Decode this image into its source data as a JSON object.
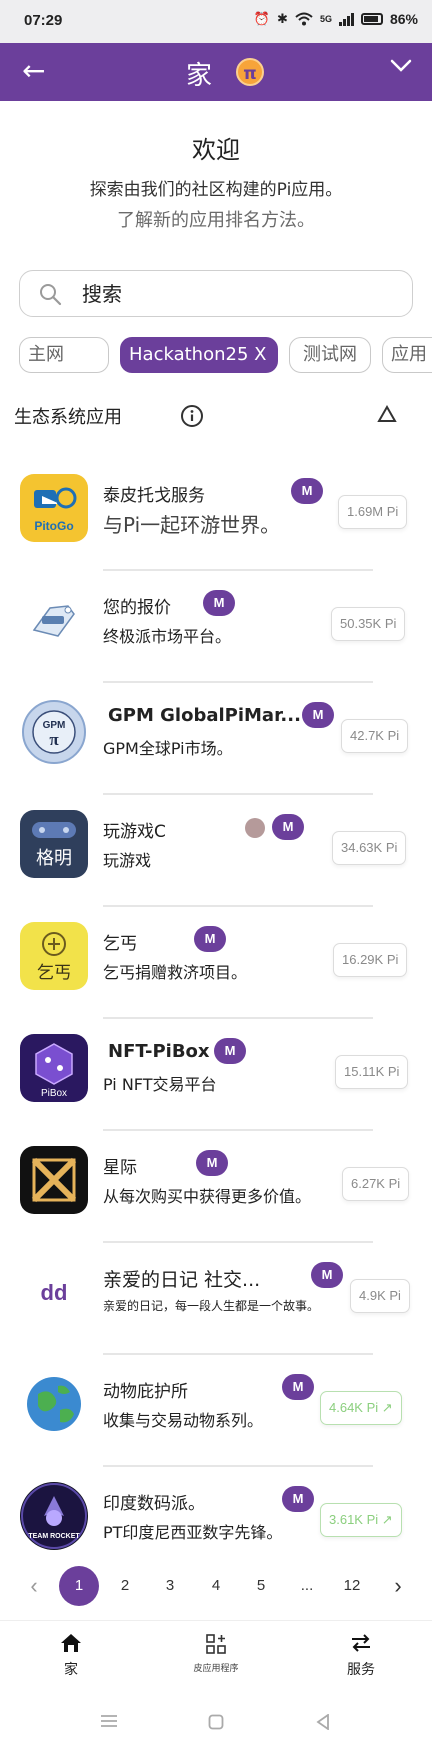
{
  "status": {
    "time": "07:29",
    "network": "5G",
    "battery": "86%"
  },
  "header": {
    "title": "家",
    "pi_symbol": "π"
  },
  "welcome": {
    "title": "欢迎",
    "subtitle": "探索由我们的社区构建的Pi应用。",
    "link": "了解新的应用排名方法。"
  },
  "search": {
    "placeholder": "搜索"
  },
  "filters": [
    "主网",
    "Hackathon25 X",
    "测试网",
    "应用"
  ],
  "section": {
    "title": "生态系统应用"
  },
  "badge_label": "M",
  "apps": [
    {
      "name": "泰皮托戈服务",
      "desc": "与Pi一起环游世界。",
      "pi": "1.69M Pi",
      "icon_text": "PitoGo",
      "trend": false
    },
    {
      "name": "您的报价",
      "desc": "终极派市场平台。",
      "pi": "50.35K Pi",
      "icon_text": "",
      "trend": false
    },
    {
      "name": "GPM GlobalPiMar...",
      "desc": "GPM全球Pi市场。",
      "pi": "42.7K Pi",
      "icon_text": "GPM",
      "trend": false
    },
    {
      "name": "玩游戏C",
      "desc": "玩游戏",
      "pi": "34.63K Pi",
      "icon_text": "格明",
      "trend": false
    },
    {
      "name": "乞丐",
      "desc": "乞丐捐赠救济项目。",
      "pi": "16.29K Pi",
      "icon_text": "乞丐",
      "trend": false
    },
    {
      "name": "NFT-PiBox",
      "desc": "Pi NFT交易平台",
      "pi": "15.11K Pi",
      "icon_text": "PiBox",
      "trend": false
    },
    {
      "name": "星际",
      "desc": "从每次购买中获得更多价值。",
      "pi": "6.27K Pi",
      "icon_text": "",
      "trend": false
    },
    {
      "name": "亲爱的日记 社交...",
      "desc": "亲爱的日记，每一段人生都是一个故事。",
      "pi": "4.9K Pi",
      "icon_text": "dd",
      "trend": false
    },
    {
      "name": "动物庇护所",
      "desc": "收集与交易动物系列。",
      "pi": "4.64K Pi",
      "icon_text": "",
      "trend": true
    },
    {
      "name": "印度数码派。",
      "desc": "PT印度尼西亚数字先锋。",
      "pi": "3.61K Pi",
      "icon_text": "TEAM ROCKET",
      "trend": true
    }
  ],
  "pagination": {
    "prev": "‹",
    "pages": [
      "1",
      "2",
      "3",
      "4",
      "5",
      "...",
      "12"
    ],
    "current": "1",
    "next": "›"
  },
  "bottom_nav": {
    "home": "家",
    "apps": "皮应用程序",
    "services": "服务"
  },
  "colors": {
    "brand": "#6b3f9b",
    "pi_orange": "#f7a43a",
    "trend_green": "#8bcf7e"
  }
}
